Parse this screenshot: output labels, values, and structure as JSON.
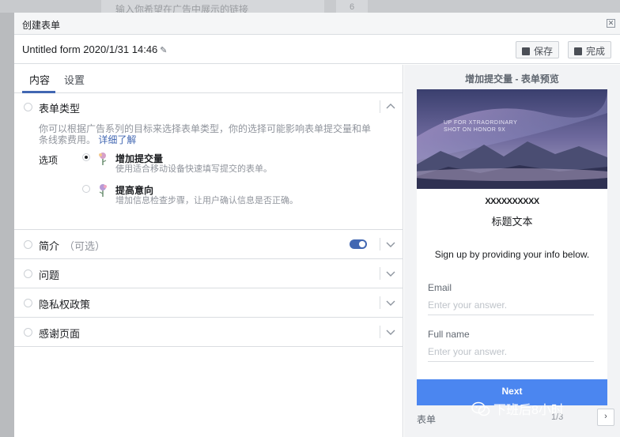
{
  "background": {
    "input_placeholder": "输入你希望在广告中展示的链接",
    "button_label": "6"
  },
  "modal": {
    "title": "创建表单",
    "close_icon": "close-icon"
  },
  "header": {
    "form_name": "Untitled form 2020/1/31 14:46",
    "edit_icon": "pencil-icon",
    "save_label": "保存",
    "done_label": "完成"
  },
  "tabs": [
    {
      "label": "内容",
      "active": true
    },
    {
      "label": "设置",
      "active": false
    }
  ],
  "form_type": {
    "title": "表单类型",
    "description": "你可以根据广告系列的目标来选择表单类型，你的选择可能影响表单提交量和单条线索费用。",
    "link": "详细了解",
    "options_label": "选项",
    "options": [
      {
        "title": "增加提交量",
        "subtitle": "使用适合移动设备快速填写提交的表单。",
        "selected": true
      },
      {
        "title": "提高意向",
        "subtitle": "增加信息检查步骤，让用户确认信息是否正确。",
        "selected": false
      }
    ]
  },
  "sections": [
    {
      "title": "简介",
      "optional": "（可选）",
      "toggle_on": true
    },
    {
      "title": "问题"
    },
    {
      "title": "隐私权政策"
    },
    {
      "title": "感谢页面"
    }
  ],
  "preview": {
    "title": "增加提交量 - 表单预览",
    "hero_text_line1": "UP FOR XTRAORDINARY",
    "hero_text_line2": "SHOT ON HONOR 9X",
    "brand_name": "XXXXXXXXXX",
    "headline": "标题文本",
    "intro": "Sign up by providing your info below.",
    "fields": [
      {
        "label": "Email",
        "placeholder": "Enter your answer."
      },
      {
        "label": "Full name",
        "placeholder": "Enter your answer."
      }
    ],
    "next_label": "Next",
    "footer_label": "表单",
    "pager": "1/3",
    "next_icon": "chevron-right-icon"
  },
  "watermark": {
    "text": "下班后8小时",
    "icon": "wechat-icon"
  },
  "colors": {
    "accent": "#4267b2",
    "next_button": "#4b86f0",
    "preview_bg": "#f2f3f5"
  }
}
